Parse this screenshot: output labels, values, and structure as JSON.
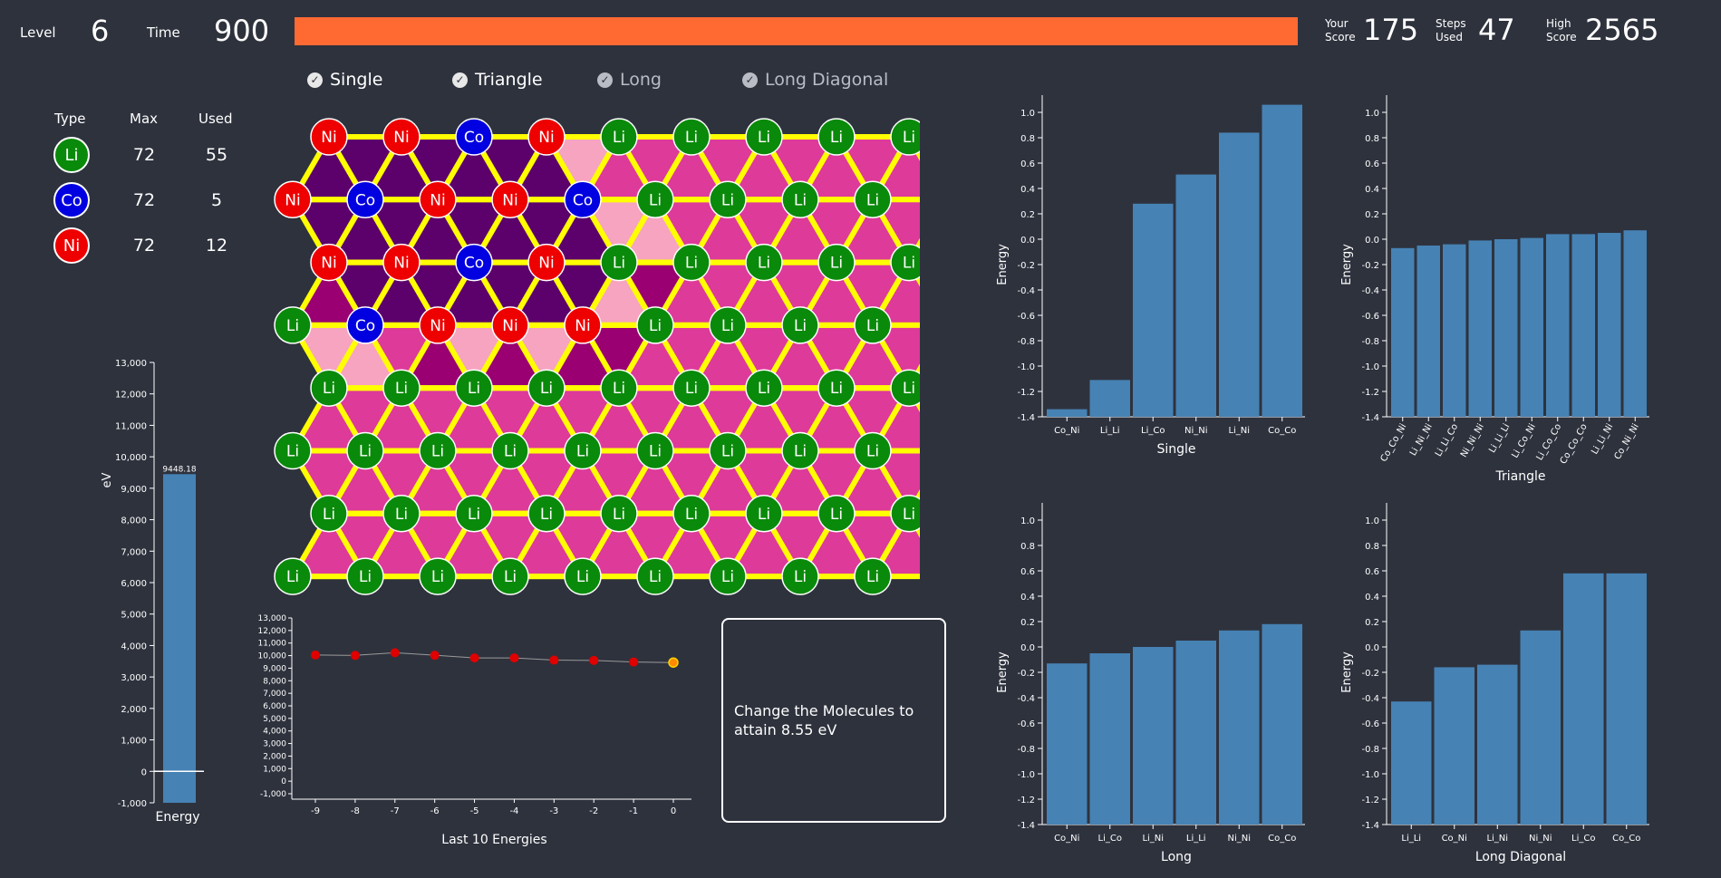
{
  "header": {
    "level_label": "Level",
    "level_value": "6",
    "time_label": "Time",
    "time_value": "900",
    "time_fraction": 1.0,
    "score_label_1": "Your",
    "score_label_2": "Score",
    "score_value": "175",
    "steps_label_1": "Steps",
    "steps_label_2": "Used",
    "steps_value": "47",
    "high_label_1": "High",
    "high_label_2": "Score",
    "high_value": "2565"
  },
  "toggles": [
    {
      "label": "Single",
      "checked": true,
      "enabled": true
    },
    {
      "label": "Triangle",
      "checked": true,
      "enabled": true
    },
    {
      "label": "Long",
      "checked": true,
      "enabled": false
    },
    {
      "label": "Long Diagonal",
      "checked": true,
      "enabled": false
    }
  ],
  "legend": {
    "headers": [
      "Type",
      "Max",
      "Used"
    ],
    "rows": [
      {
        "type": "Li",
        "max": "72",
        "used": "55",
        "color": "#0a8a0a"
      },
      {
        "type": "Co",
        "max": "72",
        "used": "5",
        "color": "#0000e0"
      },
      {
        "type": "Ni",
        "max": "72",
        "used": "12",
        "color": "#ee0000"
      }
    ]
  },
  "colors": {
    "Li": "#0a8a0a",
    "Co": "#0000e0",
    "Ni": "#ee0000",
    "bar": "#4682b4",
    "timebar": "#ff6a33",
    "edge": "#ffff00",
    "tri_default": "#dd3a9a",
    "tri_dark": "#5c006c",
    "tri_mid": "#9a0072",
    "tri_light": "#f6a4c0"
  },
  "grid": {
    "rows": [
      [
        "Ni",
        "Ni",
        "Co",
        "Ni",
        "Li",
        "Li",
        "Li",
        "Li",
        "Li"
      ],
      [
        "Ni",
        "Co",
        "Ni",
        "Ni",
        "Co",
        "Li",
        "Li",
        "Li",
        "Li"
      ],
      [
        "Ni",
        "Ni",
        "Co",
        "Ni",
        "Li",
        "Li",
        "Li",
        "Li",
        "Li"
      ],
      [
        "Li",
        "Co",
        "Ni",
        "Ni",
        "Ni",
        "Li",
        "Li",
        "Li",
        "Li"
      ],
      [
        "Li",
        "Li",
        "Li",
        "Li",
        "Li",
        "Li",
        "Li",
        "Li",
        "Li"
      ],
      [
        "Li",
        "Li",
        "Li",
        "Li",
        "Li",
        "Li",
        "Li",
        "Li",
        "Li"
      ],
      [
        "Li",
        "Li",
        "Li",
        "Li",
        "Li",
        "Li",
        "Li",
        "Li",
        "Li"
      ],
      [
        "Li",
        "Li",
        "Li",
        "Li",
        "Li",
        "Li",
        "Li",
        "Li",
        "Li"
      ]
    ],
    "shading": {
      "0": [
        "d",
        "d",
        "d",
        "d",
        "d",
        "d",
        "d",
        "l",
        "x",
        "x",
        "x",
        "x",
        "x",
        "x",
        "x",
        "x"
      ],
      "1": [
        "d",
        "d",
        "d",
        "d",
        "d",
        "d",
        "d",
        "d",
        "l",
        "l",
        "x",
        "x",
        "x",
        "x",
        "x",
        "x",
        "x"
      ],
      "2": [
        "m",
        "d",
        "d",
        "d",
        "d",
        "d",
        "d",
        "d",
        "l",
        "m",
        "x",
        "x",
        "x",
        "x",
        "x",
        "x",
        "x"
      ],
      "3": [
        "l",
        "l",
        "x",
        "m",
        "l",
        "m",
        "l",
        "m",
        "m",
        "x",
        "x",
        "x",
        "x",
        "x",
        "x",
        "x"
      ]
    }
  },
  "energy_bar": {
    "value_label": "9448.18",
    "value": 9448.18,
    "ylabel": "eV",
    "xlabel": "Energy",
    "ticks": [
      "13,000",
      "12,000",
      "11,000",
      "10,000",
      "9,000",
      "8,000",
      "7,000",
      "6,000",
      "5,000",
      "4,000",
      "3,000",
      "2,000",
      "1,000",
      "0",
      "-1,000"
    ]
  },
  "line_chart": {
    "xlabel": "Last 10 Energies",
    "x": [
      -9,
      -8,
      -7,
      -6,
      -5,
      -4,
      -3,
      -2,
      -1,
      0
    ],
    "y": [
      10050,
      10020,
      10230,
      10030,
      9820,
      9820,
      9640,
      9620,
      9490,
      9448.18
    ],
    "yticks": [
      "13,000",
      "12,000",
      "11,000",
      "10,000",
      "9,000",
      "8,000",
      "7,000",
      "6,000",
      "5,000",
      "4,000",
      "3,000",
      "2,000",
      "1,000",
      "0",
      "-1,000"
    ]
  },
  "message": "Change the Molecules to attain 8.55 eV",
  "chart_data": [
    {
      "type": "bar",
      "title": "",
      "xlabel": "Single",
      "ylabel": "Energy",
      "ylim": [
        -1.4,
        1.1
      ],
      "categories": [
        "Co_Ni",
        "Li_Li",
        "Li_Co",
        "Ni_Ni",
        "Li_Ni",
        "Co_Co"
      ],
      "values": [
        -1.34,
        -1.11,
        0.28,
        0.51,
        0.84,
        1.06
      ]
    },
    {
      "type": "bar",
      "title": "",
      "xlabel": "Triangle",
      "ylabel": "Energy",
      "ylim": [
        -1.4,
        1.1
      ],
      "categories": [
        "Co_Co_Ni",
        "Li_Ni_Ni",
        "Li_Li_Co",
        "Ni_Ni_Ni",
        "Li_Li_Li",
        "Li_Co_Ni",
        "Li_Co_Co",
        "Co_Co_Co",
        "Li_Li_Ni",
        "Co_Ni_Ni"
      ],
      "values": [
        -0.07,
        -0.05,
        -0.04,
        -0.01,
        0.0,
        0.01,
        0.04,
        0.04,
        0.05,
        0.07
      ]
    },
    {
      "type": "bar",
      "title": "",
      "xlabel": "Long",
      "ylabel": "Energy",
      "ylim": [
        -1.4,
        1.1
      ],
      "categories": [
        "Co_Ni",
        "Li_Co",
        "Li_Ni",
        "Li_Li",
        "Ni_Ni",
        "Co_Co"
      ],
      "values": [
        -0.13,
        -0.05,
        0.0,
        0.05,
        0.13,
        0.18
      ]
    },
    {
      "type": "bar",
      "title": "",
      "xlabel": "Long Diagonal",
      "ylabel": "Energy",
      "ylim": [
        -1.4,
        1.1
      ],
      "categories": [
        "Li_Li",
        "Co_Ni",
        "Li_Ni",
        "Ni_Ni",
        "Li_Co",
        "Co_Co"
      ],
      "values": [
        -0.43,
        -0.16,
        -0.14,
        0.13,
        0.58,
        0.58
      ]
    }
  ]
}
